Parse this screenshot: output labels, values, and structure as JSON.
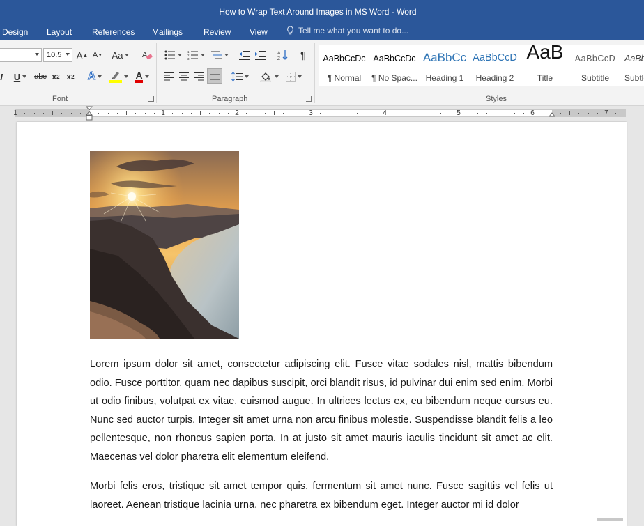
{
  "window": {
    "title": "How to Wrap Text Around Images in MS Word - Word"
  },
  "tabs": [
    "Design",
    "Layout",
    "References",
    "Mailings",
    "Review",
    "View"
  ],
  "tell_me": {
    "placeholder": "Tell me what you want to do..."
  },
  "font_group": {
    "label": "Font",
    "font_name": "",
    "font_size": "10.5",
    "grow_label": "A",
    "shrink_label": "A",
    "change_case_label": "Aa",
    "underline_label": "U",
    "strike_label": "abc",
    "subscript_label": "x",
    "superscript_label": "x",
    "sub_digit": "2",
    "font_color_label": "A",
    "text_effects_label": "A"
  },
  "paragraph_group": {
    "label": "Paragraph"
  },
  "styles_group": {
    "label": "Styles",
    "items": [
      {
        "sample": "AaBbCcDc",
        "name": "¶ Normal"
      },
      {
        "sample": "AaBbCcDc",
        "name": "¶ No Spac..."
      },
      {
        "sample": "AaBbCc",
        "name": "Heading 1"
      },
      {
        "sample": "AaBbCcD",
        "name": "Heading 2"
      },
      {
        "sample": "AaB",
        "name": "Title"
      },
      {
        "sample": "AaBbCcD",
        "name": "Subtitle"
      },
      {
        "sample": "AaBb",
        "name": "Subtle"
      }
    ]
  },
  "ruler": {
    "numbers": [
      "1",
      "1",
      "2",
      "3",
      "4",
      "5",
      "6",
      "7"
    ]
  },
  "document": {
    "paragraphs": [
      "Lorem ipsum dolor sit amet, consectetur adipiscing elit. Fusce vitae sodales nisl, mattis bibendum odio. Fusce porttitor, quam nec dapibus suscipit, orci blandit risus, id pulvinar dui enim sed enim. Morbi ut odio finibus, volutpat ex vitae, euismod augue. In ultrices lectus ex, eu bibendum neque cursus eu. Nunc sed auctor turpis. Integer sit amet urna non arcu finibus molestie. Suspendisse blandit felis a leo pellentesque, non rhoncus sapien porta. In at justo sit amet mauris iaculis tincidunt sit amet ac elit. Maecenas vel dolor pharetra elit elementum eleifend.",
      "Morbi felis eros, tristique sit amet tempor quis, fermentum sit amet nunc. Fusce sagittis vel felis ut laoreet. Aenean tristique lacinia urna, nec pharetra ex bibendum eget. Integer auctor mi id dolor"
    ]
  },
  "colors": {
    "brand_blue": "#2b579a",
    "ribbon_bg": "#f3f3f3",
    "highlight_yellow": "#ffff00",
    "font_color_red": "#e00000",
    "heading_blue": "#2e74b5"
  }
}
